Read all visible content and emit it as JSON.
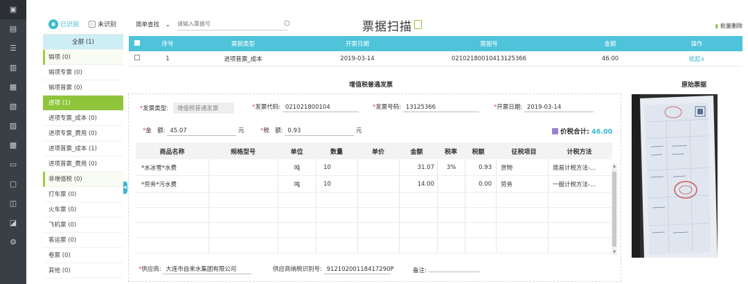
{
  "rail": {
    "icons": [
      "scan-icon",
      "document-icon",
      "list-icon",
      "chart-icon",
      "building-icon",
      "receipt-icon",
      "book-icon",
      "gift-icon",
      "wallet-icon",
      "image-icon",
      "stamp-icon",
      "search-doc-icon",
      "settings-icon"
    ]
  },
  "left": {
    "tab_recognized": "已识别",
    "tab_unrecognized": "未识别",
    "categories": [
      {
        "label": "全部 (1)",
        "kind": "all"
      },
      {
        "label": "销项 (0)",
        "kind": "grp"
      },
      {
        "label": "销项专票 (0)",
        "kind": "item"
      },
      {
        "label": "销项普票 (0)",
        "kind": "item"
      },
      {
        "label": "进项 (1)",
        "kind": "sel"
      },
      {
        "label": "进项专票_成本 (0)",
        "kind": "item"
      },
      {
        "label": "进项专票_费用 (0)",
        "kind": "item"
      },
      {
        "label": "进项普票_成本 (1)",
        "kind": "item"
      },
      {
        "label": "进项普票_费用 (0)",
        "kind": "item"
      },
      {
        "label": "非增值税 (0)",
        "kind": "grp"
      },
      {
        "label": "打车票 (0)",
        "kind": "item"
      },
      {
        "label": "火车票 (0)",
        "kind": "item"
      },
      {
        "label": "飞机票 (0)",
        "kind": "item"
      },
      {
        "label": "客运票 (0)",
        "kind": "item"
      },
      {
        "label": "卷票 (0)",
        "kind": "item"
      },
      {
        "label": "其他 (0)",
        "kind": "item"
      }
    ]
  },
  "toolbar": {
    "search_mode": "简单查找",
    "search_placeholder": "请输入票据号",
    "title": "票据扫描",
    "batch_delete": "批量删除"
  },
  "grid": {
    "headers": [
      "序号",
      "票据类型",
      "开票日期",
      "票据号",
      "金额",
      "操作"
    ],
    "rows": [
      {
        "index": "1",
        "type": "进项普票_成本",
        "date": "2019-03-14",
        "number": "02102180010413125366",
        "amount": "46.00",
        "action": "收起∧"
      }
    ]
  },
  "detail": {
    "section_title": "增值税普通发票",
    "original_title": "原始票据",
    "invoice_type_label": "发票类型:",
    "invoice_type_value": "增值税普通发票",
    "invoice_code_label": "发票代码:",
    "invoice_code_value": "021021800104",
    "invoice_no_label": "发票号码:",
    "invoice_no_value": "13125366",
    "issue_date_label": "开票日期:",
    "issue_date_value": "2019-03-14",
    "amount_label": "金　额:",
    "amount_value": "45.07",
    "amount_unit": "元",
    "tax_label": "税　额:",
    "tax_value": "0.93",
    "tax_unit": "元",
    "total_label": "价税合计:",
    "total_value": "46.00",
    "item_headers": [
      "商品名称",
      "规格型号",
      "单位",
      "数量",
      "单价",
      "金额",
      "税率",
      "税额",
      "征税项目",
      "计税方法"
    ],
    "items": [
      {
        "name": "*水冰雪*水费",
        "spec": "",
        "unit": "吨",
        "qty": "10",
        "price": "",
        "amount": "31.07",
        "rate": "3%",
        "tax": "0.93",
        "category": "货物",
        "method": "简易计税方法-..."
      },
      {
        "name": "*劳务*污水费",
        "spec": "",
        "unit": "吨",
        "qty": "10",
        "price": "",
        "amount": "14.00",
        "rate": "",
        "tax": "0.00",
        "category": "劳务",
        "method": "一般计税方法-..."
      }
    ],
    "supplier_label": "供应商:",
    "supplier_value": "大连市自来水集团有限公司",
    "supplier_taxid_label": "供应商纳税识别号:",
    "supplier_taxid_value": "91210200118417290P",
    "note_label": "备注:",
    "note_value": ""
  }
}
